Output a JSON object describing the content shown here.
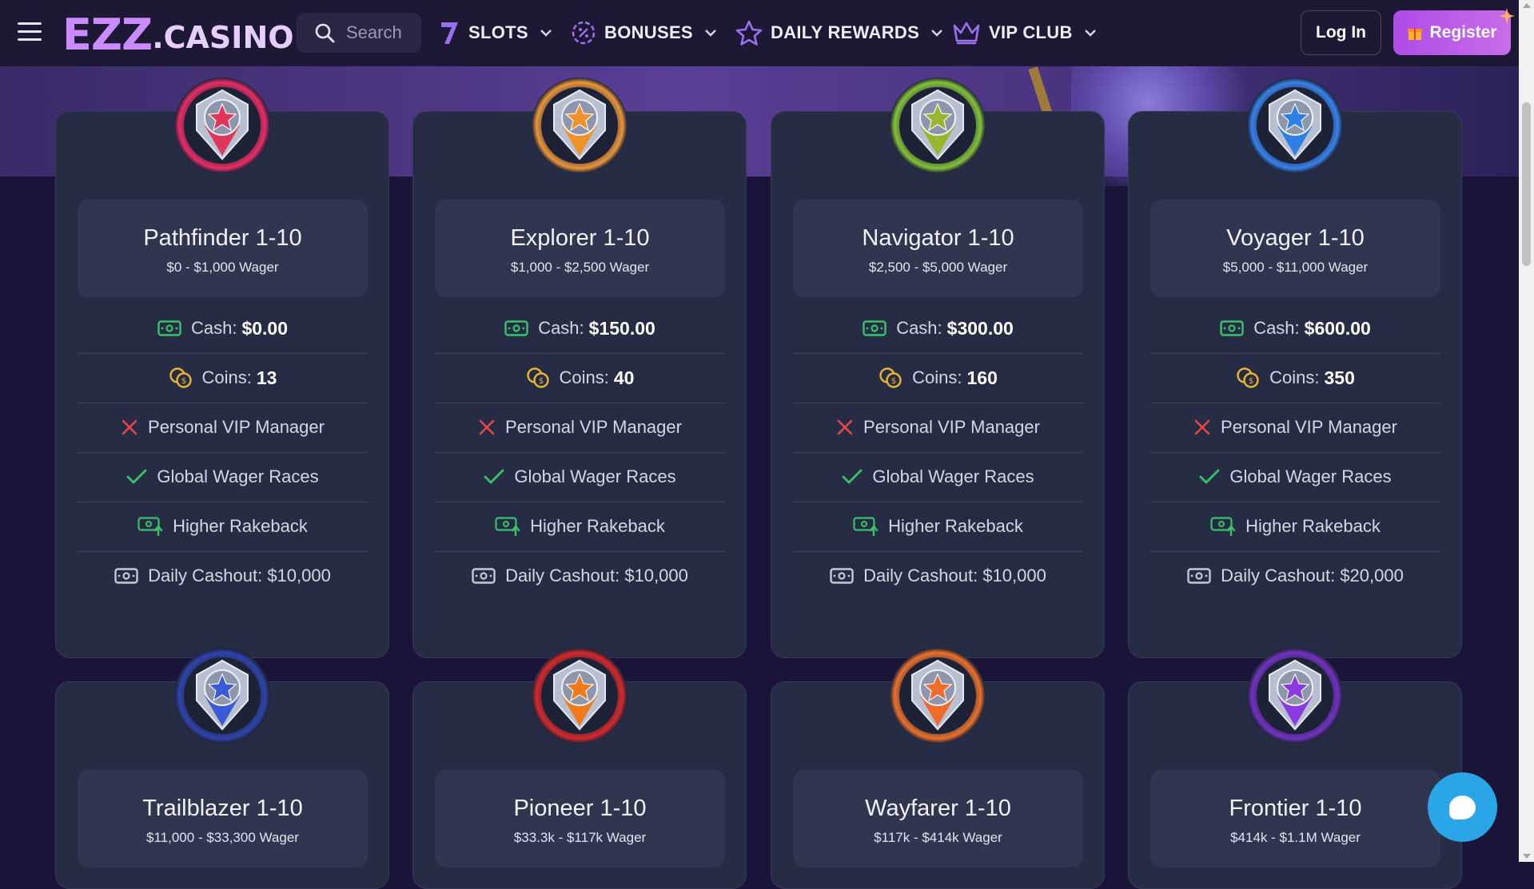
{
  "header": {
    "logo_main": "EZZ",
    "logo_rest": ".CASINO",
    "search_placeholder": "Search",
    "nav": [
      {
        "label": "SLOTS"
      },
      {
        "label": "BONUSES"
      },
      {
        "label": "DAILY REWARDS"
      },
      {
        "label": "VIP CLUB"
      }
    ],
    "login_label": "Log In",
    "register_label": "Register"
  },
  "tiers": [
    {
      "name": "Pathfinder 1-10",
      "wager": "$0 - $1,000 Wager",
      "badge_color": "#e0365a",
      "glow": "#ff2e6a",
      "cash_label": "Cash:",
      "cash": "$0.00",
      "coins_label": "Coins:",
      "coins": "13",
      "vip_manager": "Personal VIP Manager",
      "races": "Global Wager Races",
      "rakeback": "Higher Rakeback",
      "cashout": "Daily Cashout: $10,000"
    },
    {
      "name": "Explorer 1-10",
      "wager": "$1,000 - $2,500 Wager",
      "badge_color": "#f0922a",
      "glow": "#ffa23a",
      "cash_label": "Cash:",
      "cash": "$150.00",
      "coins_label": "Coins:",
      "coins": "40",
      "vip_manager": "Personal VIP Manager",
      "races": "Global Wager Races",
      "rakeback": "Higher Rakeback",
      "cashout": "Daily Cashout: $10,000"
    },
    {
      "name": "Navigator 1-10",
      "wager": "$2,500 - $5,000 Wager",
      "badge_color": "#9ab62e",
      "glow": "#8fd23a",
      "cash_label": "Cash:",
      "cash": "$300.00",
      "coins_label": "Coins:",
      "coins": "160",
      "vip_manager": "Personal VIP Manager",
      "races": "Global Wager Races",
      "rakeback": "Higher Rakeback",
      "cashout": "Daily Cashout: $10,000"
    },
    {
      "name": "Voyager 1-10",
      "wager": "$5,000 - $11,000 Wager",
      "badge_color": "#2f7fe6",
      "glow": "#3a8cff",
      "cash_label": "Cash:",
      "cash": "$600.00",
      "coins_label": "Coins:",
      "coins": "350",
      "vip_manager": "Personal VIP Manager",
      "races": "Global Wager Races",
      "rakeback": "Higher Rakeback",
      "cashout": "Daily Cashout: $20,000"
    },
    {
      "name": "Trailblazer 1-10",
      "wager": "$11,000 - $33,300 Wager",
      "badge_color": "#3a5ad8",
      "glow": "#3048b8"
    },
    {
      "name": "Pioneer 1-10",
      "wager": "$33.3k - $117k Wager",
      "badge_color": "#f07a1a",
      "glow": "#e82a2a"
    },
    {
      "name": "Wayfarer 1-10",
      "wager": "$117k - $414k Wager",
      "badge_color": "#f06a2a",
      "glow": "#ff7a2a"
    },
    {
      "name": "Frontier 1-10",
      "wager": "$414k - $1.1M Wager",
      "badge_color": "#8a3ae0",
      "glow": "#7a34d0"
    }
  ],
  "colors": {
    "accent_purple": "#c98bff",
    "check_green": "#3ac26a",
    "cross_red": "#e8444a",
    "coin_gold": "#e8b531",
    "chat_blue": "#2aa5e8"
  }
}
